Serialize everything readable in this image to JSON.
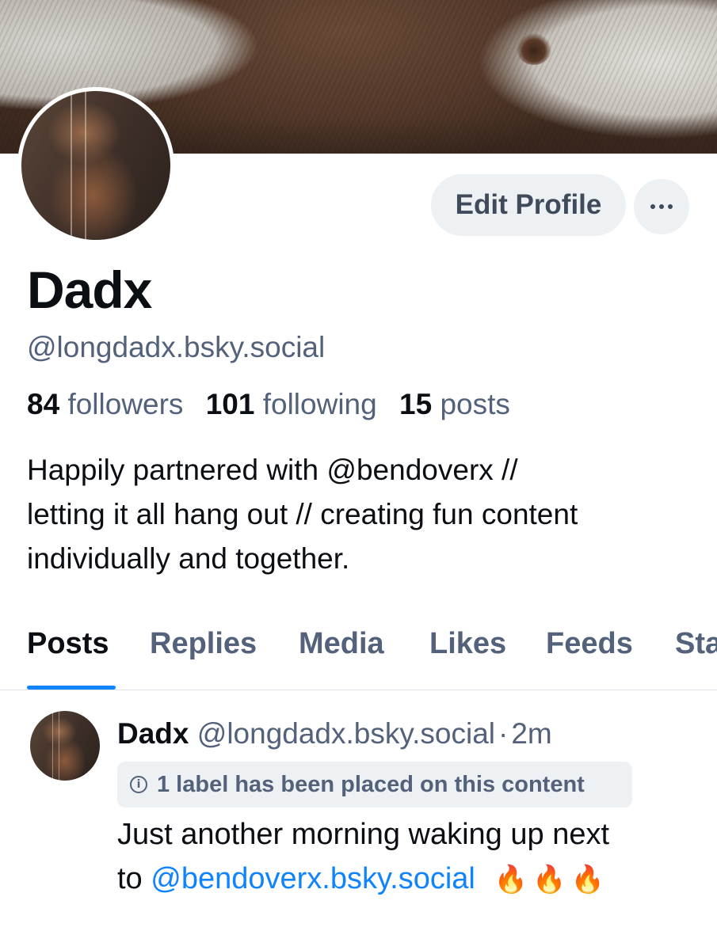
{
  "profile": {
    "display_name": "Dadx",
    "handle": "@longdadx.bsky.social",
    "edit_button_label": "Edit Profile",
    "more_button_icon": "ellipsis-icon",
    "stats": {
      "followers_count": "84",
      "followers_label": "followers",
      "following_count": "101",
      "following_label": "following",
      "posts_count": "15",
      "posts_label": "posts"
    },
    "bio_lines": [
      "Happily partnered with @bendoverx //",
      "letting it all hang out // creating fun content",
      "individually and together."
    ]
  },
  "tabs": [
    {
      "label": "Posts",
      "active": true
    },
    {
      "label": "Replies",
      "active": false
    },
    {
      "label": "Media",
      "active": false
    },
    {
      "label": "Likes",
      "active": false
    },
    {
      "label": "Feeds",
      "active": false
    },
    {
      "label": "Sta",
      "active": false
    }
  ],
  "post": {
    "author": "Dadx",
    "handle": "@longdadx.bsky.social",
    "separator": "·",
    "time": "2m",
    "label_notice": "1 label has been placed on this content",
    "text_part1": "Just another morning waking up next",
    "text_part2": "to ",
    "mention": "@bendoverx.bsky.social",
    "flames": "🔥🔥🔥"
  },
  "colors": {
    "accent": "#1083fe",
    "muted_text": "#53627a",
    "button_bg": "#eef1f4",
    "text": "#0b0f14"
  }
}
